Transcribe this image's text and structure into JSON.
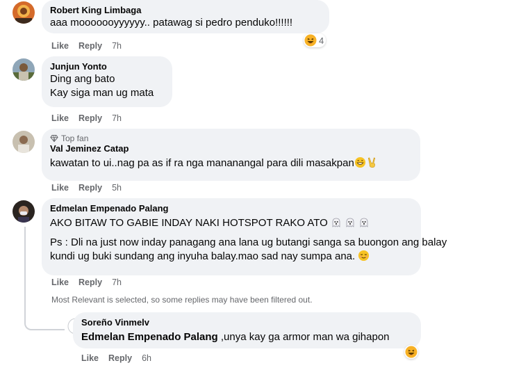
{
  "comments": [
    {
      "name": "Robert King Limbaga",
      "lines": [
        "aaa mooooooyyyyyy.. patawag si pedro penduko!!!!!!"
      ],
      "like": "Like",
      "reply": "Reply",
      "time": "7h",
      "reaction_count": "4",
      "reaction_icon": "haha-reaction-icon"
    },
    {
      "name": "Junjun Yonto",
      "lines": [
        "Ding ang bato",
        "Kay siga man ug mata"
      ],
      "like": "Like",
      "reply": "Reply",
      "time": "7h"
    },
    {
      "badge": "Top fan",
      "name": "Val Jeminez Catap",
      "lines": [
        "kawatan to ui..nag pa as if ra nga mananangal para dili masakpan"
      ],
      "like": "Like",
      "reply": "Reply",
      "time": "5h"
    },
    {
      "name": "Edmelan Empenado Palang",
      "line1": "AKO BITAW TO GABIE INDAY NAKI HOTSPOT RAKO ATO",
      "para2_line1": "Ps : Dli na just now inday panagang ana lana ug butangi sanga sa buongon ang balay",
      "para2_line2": "kundi ug buki sundang ang inyuha balay.mao sad nay sumpa ana.",
      "like": "Like",
      "reply": "Reply",
      "time": "7h"
    }
  ],
  "filter_note": "Most Relevant is selected, so some replies may have been filtered out.",
  "reply": {
    "name": "Soreño Vinmelv",
    "mention": "Edmelan Empenado Palang",
    "text": " ,unya kay ga armor man wa gihapon",
    "like": "Like",
    "reply": "Reply",
    "time": "6h",
    "reaction_icon": "haha-reaction-icon"
  },
  "colors": {
    "bubble": "#f0f2f5",
    "secondary_text": "#65676b",
    "haha_yellow": "#f7b125"
  }
}
